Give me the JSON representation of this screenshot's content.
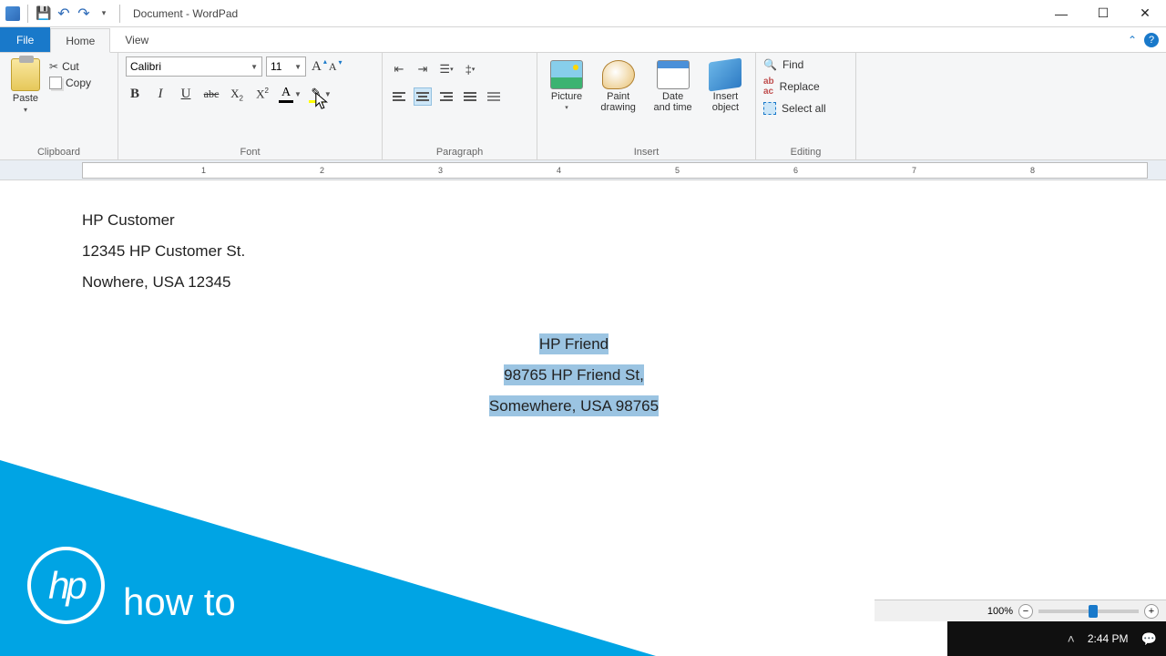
{
  "titlebar": {
    "title": "Document - WordPad"
  },
  "tabs": {
    "file": "File",
    "home": "Home",
    "view": "View"
  },
  "clipboard": {
    "paste": "Paste",
    "cut": "Cut",
    "copy": "Copy",
    "group": "Clipboard"
  },
  "font": {
    "name": "Calibri",
    "size": "11",
    "group": "Font"
  },
  "paragraph": {
    "group": "Paragraph"
  },
  "insert": {
    "picture": "Picture",
    "paint": "Paint drawing",
    "date": "Date and time",
    "object": "Insert object",
    "group": "Insert"
  },
  "editing": {
    "find": "Find",
    "replace": "Replace",
    "selectall": "Select all",
    "group": "Editing"
  },
  "ruler": {
    "n1": "1",
    "n2": "2",
    "n3": "3",
    "n4": "4",
    "n5": "5",
    "n6": "6",
    "n7": "7",
    "n8": "8"
  },
  "doc": {
    "l1": "HP Customer",
    "l2": "12345 HP Customer St.",
    "l3": "Nowhere, USA 12345",
    "r1": "HP Friend",
    "r2": "98765 HP Friend St,",
    "r3": "Somewhere,  USA 98765"
  },
  "status": {
    "zoom": "100%"
  },
  "taskbar": {
    "time": "2:44 PM"
  },
  "overlay": {
    "logo": "hp",
    "text": "how to"
  }
}
